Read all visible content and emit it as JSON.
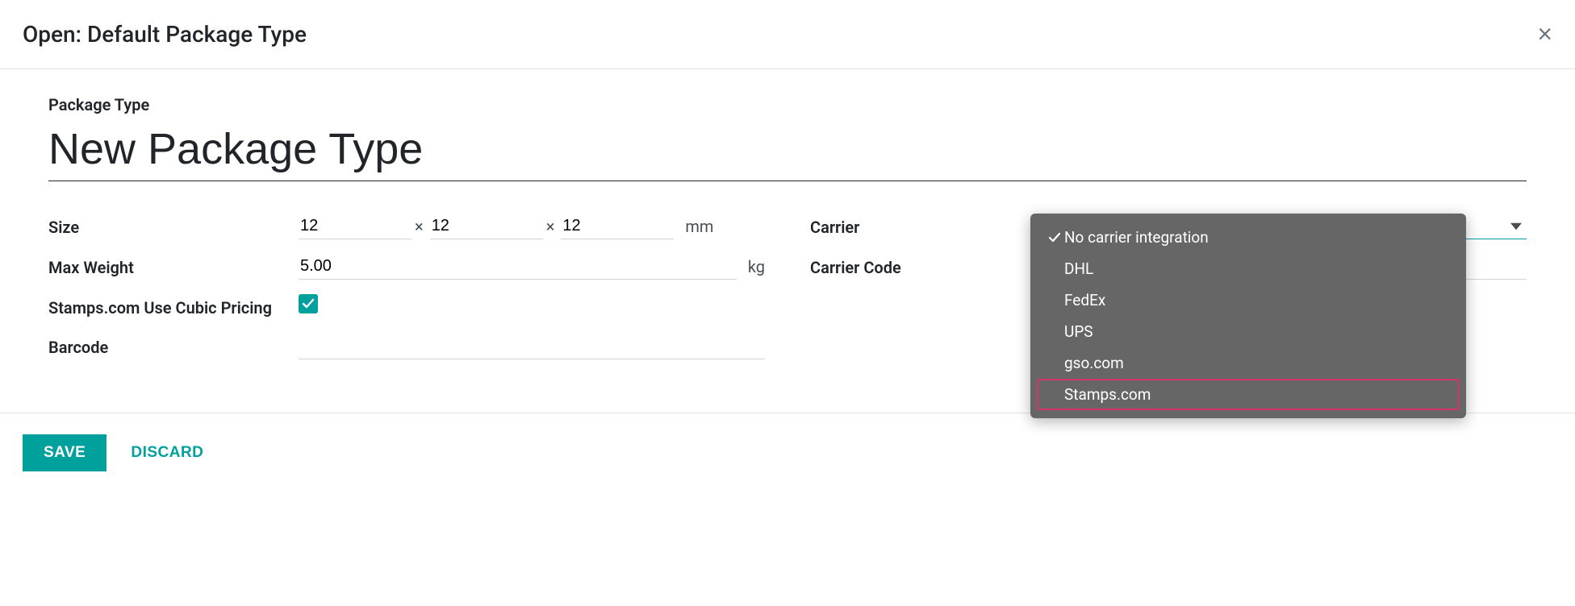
{
  "header": {
    "title": "Open: Default Package Type"
  },
  "form": {
    "package_type_label": "Package Type",
    "package_type_value": "New Package Type",
    "size_label": "Size",
    "size_l": "12",
    "size_w": "12",
    "size_h": "12",
    "size_sep": "×",
    "size_unit": "mm",
    "max_weight_label": "Max Weight",
    "max_weight_value": "5.00",
    "weight_unit": "kg",
    "cubic_label": "Stamps.com Use Cubic Pricing",
    "cubic_checked": true,
    "barcode_label": "Barcode",
    "barcode_value": "",
    "carrier_label": "Carrier",
    "carrier_value": "",
    "carrier_code_label": "Carrier Code",
    "carrier_code_value": ""
  },
  "dropdown": {
    "options": [
      "No carrier integration",
      "DHL",
      "FedEx",
      "UPS",
      "gso.com",
      "Stamps.com"
    ],
    "selected_index": 0,
    "highlighted_index": 5
  },
  "footer": {
    "save_label": "SAVE",
    "discard_label": "DISCARD"
  }
}
